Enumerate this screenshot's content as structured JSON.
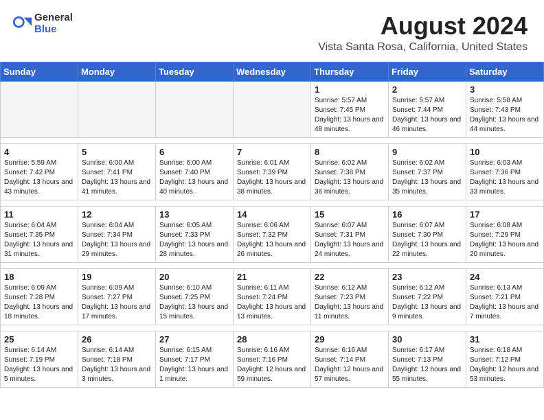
{
  "header": {
    "logo_general": "General",
    "logo_blue": "Blue",
    "month_year": "August 2024",
    "location": "Vista Santa Rosa, California, United States"
  },
  "weekdays": [
    "Sunday",
    "Monday",
    "Tuesday",
    "Wednesday",
    "Thursday",
    "Friday",
    "Saturday"
  ],
  "weeks": [
    [
      {
        "day": "",
        "info": ""
      },
      {
        "day": "",
        "info": ""
      },
      {
        "day": "",
        "info": ""
      },
      {
        "day": "",
        "info": ""
      },
      {
        "day": "1",
        "info": "Sunrise: 5:57 AM\nSunset: 7:45 PM\nDaylight: 13 hours\nand 48 minutes."
      },
      {
        "day": "2",
        "info": "Sunrise: 5:57 AM\nSunset: 7:44 PM\nDaylight: 13 hours\nand 46 minutes."
      },
      {
        "day": "3",
        "info": "Sunrise: 5:58 AM\nSunset: 7:43 PM\nDaylight: 13 hours\nand 44 minutes."
      }
    ],
    [
      {
        "day": "4",
        "info": "Sunrise: 5:59 AM\nSunset: 7:42 PM\nDaylight: 13 hours\nand 43 minutes."
      },
      {
        "day": "5",
        "info": "Sunrise: 6:00 AM\nSunset: 7:41 PM\nDaylight: 13 hours\nand 41 minutes."
      },
      {
        "day": "6",
        "info": "Sunrise: 6:00 AM\nSunset: 7:40 PM\nDaylight: 13 hours\nand 40 minutes."
      },
      {
        "day": "7",
        "info": "Sunrise: 6:01 AM\nSunset: 7:39 PM\nDaylight: 13 hours\nand 38 minutes."
      },
      {
        "day": "8",
        "info": "Sunrise: 6:02 AM\nSunset: 7:38 PM\nDaylight: 13 hours\nand 36 minutes."
      },
      {
        "day": "9",
        "info": "Sunrise: 6:02 AM\nSunset: 7:37 PM\nDaylight: 13 hours\nand 35 minutes."
      },
      {
        "day": "10",
        "info": "Sunrise: 6:03 AM\nSunset: 7:36 PM\nDaylight: 13 hours\nand 33 minutes."
      }
    ],
    [
      {
        "day": "11",
        "info": "Sunrise: 6:04 AM\nSunset: 7:35 PM\nDaylight: 13 hours\nand 31 minutes."
      },
      {
        "day": "12",
        "info": "Sunrise: 6:04 AM\nSunset: 7:34 PM\nDaylight: 13 hours\nand 29 minutes."
      },
      {
        "day": "13",
        "info": "Sunrise: 6:05 AM\nSunset: 7:33 PM\nDaylight: 13 hours\nand 28 minutes."
      },
      {
        "day": "14",
        "info": "Sunrise: 6:06 AM\nSunset: 7:32 PM\nDaylight: 13 hours\nand 26 minutes."
      },
      {
        "day": "15",
        "info": "Sunrise: 6:07 AM\nSunset: 7:31 PM\nDaylight: 13 hours\nand 24 minutes."
      },
      {
        "day": "16",
        "info": "Sunrise: 6:07 AM\nSunset: 7:30 PM\nDaylight: 13 hours\nand 22 minutes."
      },
      {
        "day": "17",
        "info": "Sunrise: 6:08 AM\nSunset: 7:29 PM\nDaylight: 13 hours\nand 20 minutes."
      }
    ],
    [
      {
        "day": "18",
        "info": "Sunrise: 6:09 AM\nSunset: 7:28 PM\nDaylight: 13 hours\nand 18 minutes."
      },
      {
        "day": "19",
        "info": "Sunrise: 6:09 AM\nSunset: 7:27 PM\nDaylight: 13 hours\nand 17 minutes."
      },
      {
        "day": "20",
        "info": "Sunrise: 6:10 AM\nSunset: 7:25 PM\nDaylight: 13 hours\nand 15 minutes."
      },
      {
        "day": "21",
        "info": "Sunrise: 6:11 AM\nSunset: 7:24 PM\nDaylight: 13 hours\nand 13 minutes."
      },
      {
        "day": "22",
        "info": "Sunrise: 6:12 AM\nSunset: 7:23 PM\nDaylight: 13 hours\nand 11 minutes."
      },
      {
        "day": "23",
        "info": "Sunrise: 6:12 AM\nSunset: 7:22 PM\nDaylight: 13 hours\nand 9 minutes."
      },
      {
        "day": "24",
        "info": "Sunrise: 6:13 AM\nSunset: 7:21 PM\nDaylight: 13 hours\nand 7 minutes."
      }
    ],
    [
      {
        "day": "25",
        "info": "Sunrise: 6:14 AM\nSunset: 7:19 PM\nDaylight: 13 hours\nand 5 minutes."
      },
      {
        "day": "26",
        "info": "Sunrise: 6:14 AM\nSunset: 7:18 PM\nDaylight: 13 hours\nand 3 minutes."
      },
      {
        "day": "27",
        "info": "Sunrise: 6:15 AM\nSunset: 7:17 PM\nDaylight: 13 hours\nand 1 minute."
      },
      {
        "day": "28",
        "info": "Sunrise: 6:16 AM\nSunset: 7:16 PM\nDaylight: 12 hours\nand 59 minutes."
      },
      {
        "day": "29",
        "info": "Sunrise: 6:16 AM\nSunset: 7:14 PM\nDaylight: 12 hours\nand 57 minutes."
      },
      {
        "day": "30",
        "info": "Sunrise: 6:17 AM\nSunset: 7:13 PM\nDaylight: 12 hours\nand 55 minutes."
      },
      {
        "day": "31",
        "info": "Sunrise: 6:18 AM\nSunset: 7:12 PM\nDaylight: 12 hours\nand 53 minutes."
      }
    ]
  ]
}
